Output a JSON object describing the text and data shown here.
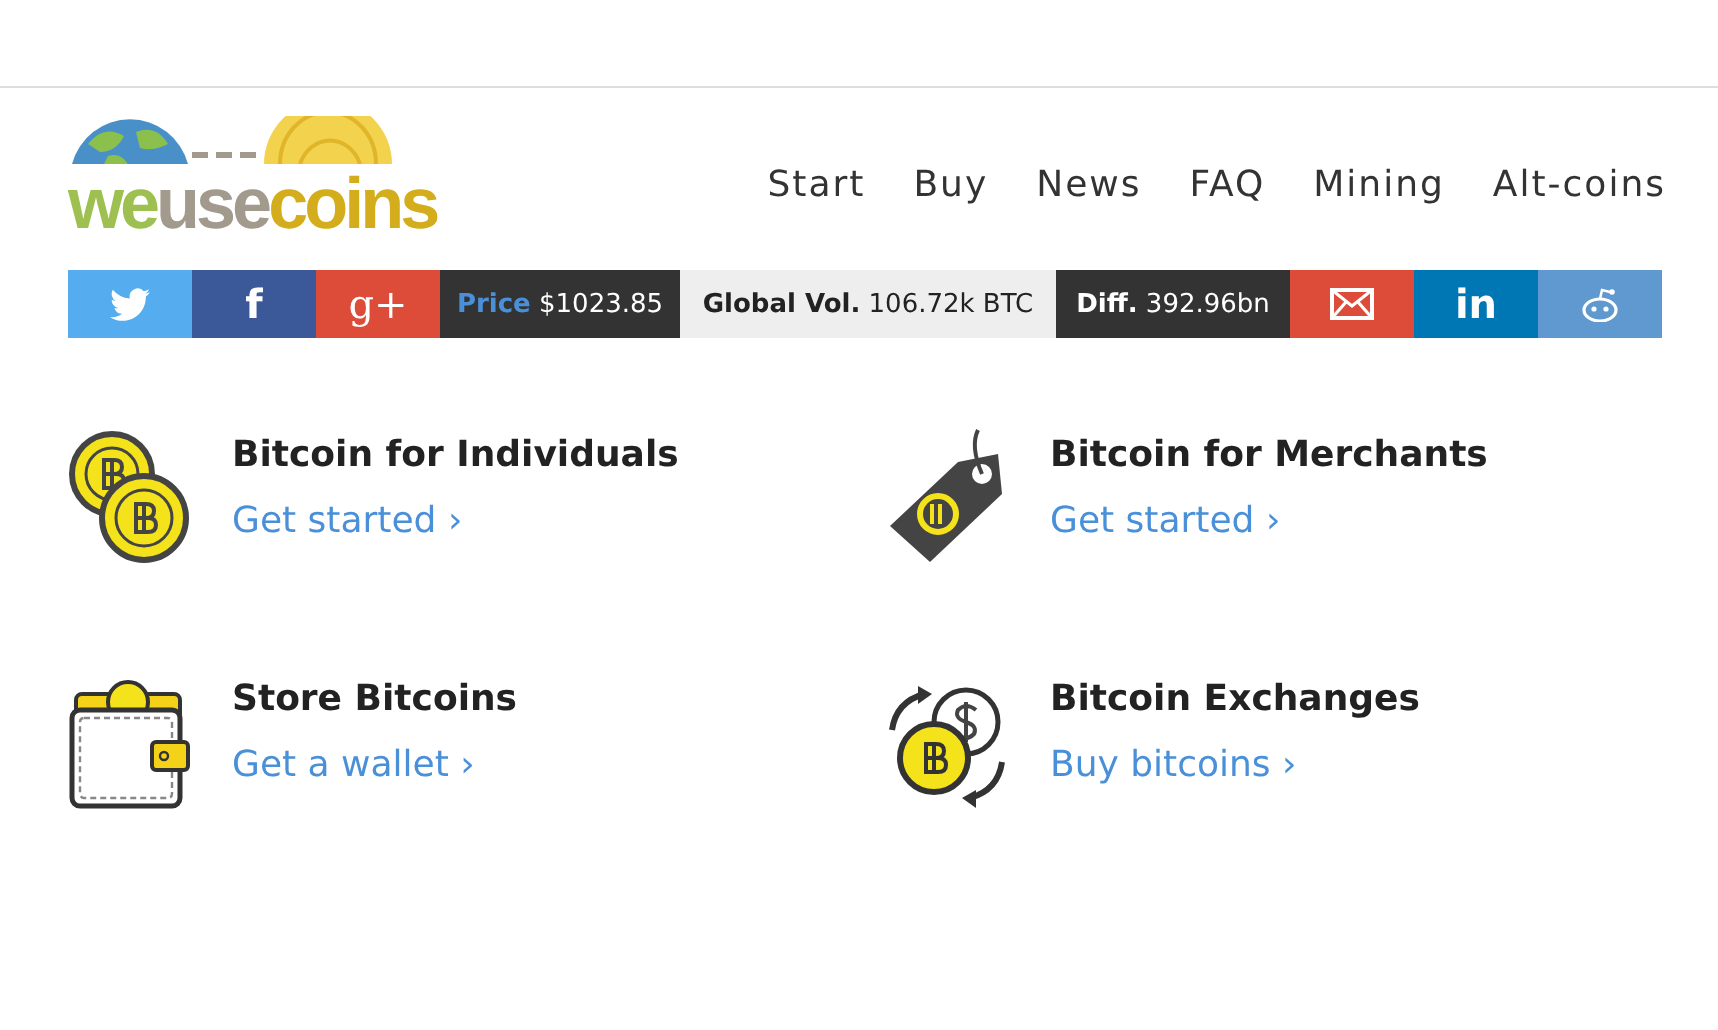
{
  "logo": {
    "parts": [
      {
        "text": "we",
        "color": "#9dc050"
      },
      {
        "text": "use",
        "color": "#a39a8e"
      },
      {
        "text": "coins",
        "color": "#d4ad1c"
      }
    ]
  },
  "nav": [
    "Start",
    "Buy",
    "News",
    "FAQ",
    "Mining",
    "Alt-coins"
  ],
  "share_bar": [
    {
      "kind": "twitter",
      "color": "#55acee"
    },
    {
      "kind": "facebook",
      "color": "#3b5998",
      "label": "f"
    },
    {
      "kind": "google",
      "color": "#dd4b39",
      "label": "g+"
    },
    {
      "kind": "stat",
      "label": "Price",
      "value": "$1023.85"
    },
    {
      "kind": "stat",
      "label": "Global Vol.",
      "value": "106.72k BTC"
    },
    {
      "kind": "stat",
      "label": "Diff.",
      "value": "392.96bn"
    },
    {
      "kind": "email",
      "color": "#dd4b39"
    },
    {
      "kind": "linkedin",
      "color": "#0077b5",
      "label": "in"
    },
    {
      "kind": "reddit",
      "color": "#5f99cf"
    }
  ],
  "features": [
    {
      "title": "Bitcoin for Individuals",
      "link": "Get started ›"
    },
    {
      "title": "Bitcoin for Merchants",
      "link": "Get started ›"
    },
    {
      "title": "Store Bitcoins",
      "link": "Get a wallet ›"
    },
    {
      "title": "Bitcoin Exchanges",
      "link": "Buy bitcoins ›"
    }
  ]
}
